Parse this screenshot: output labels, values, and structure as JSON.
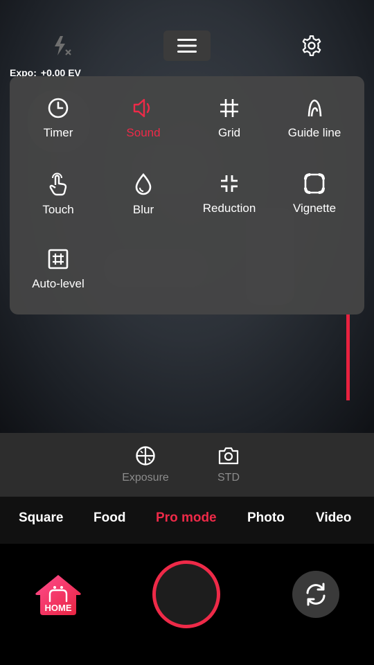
{
  "top_bar": {
    "flash_icon": "flash-off-icon",
    "menu_icon": "hamburger-menu-icon",
    "settings_icon": "gear-icon"
  },
  "exposure_readout": {
    "label": "Expo:",
    "value": "+0.00 EV"
  },
  "settings_panel": {
    "options": [
      {
        "label": "Timer",
        "icon": "clock-icon",
        "active": false
      },
      {
        "label": "Sound",
        "icon": "speaker-icon",
        "active": true
      },
      {
        "label": "Grid",
        "icon": "grid-hash-icon",
        "active": false
      },
      {
        "label": "Guide line",
        "icon": "guide-line-icon",
        "active": false
      },
      {
        "label": "Touch",
        "icon": "touch-hand-icon",
        "active": false
      },
      {
        "label": "Blur",
        "icon": "drop-icon",
        "active": false
      },
      {
        "label": "Reduction",
        "icon": "reduction-arrows-icon",
        "active": false
      },
      {
        "label": "Vignette",
        "icon": "vignette-icon",
        "active": false
      },
      {
        "label": "Auto-level",
        "icon": "auto-level-icon",
        "active": false
      }
    ]
  },
  "pro_controls": [
    {
      "label": "Exposure",
      "icon": "exposure-icon"
    },
    {
      "label": "STD",
      "icon": "camera-icon"
    }
  ],
  "mode_tabs": [
    {
      "label": "Square",
      "active": false
    },
    {
      "label": "Food",
      "active": false
    },
    {
      "label": "Pro mode",
      "active": true
    },
    {
      "label": "Photo",
      "active": false
    },
    {
      "label": "Video",
      "active": false
    }
  ],
  "bottom_bar": {
    "home_label": "HOME",
    "home_icon": "home-icon",
    "flip_icon": "flip-camera-icon"
  },
  "colors": {
    "accent": "#ee2a48",
    "panel": "#464646",
    "text": "#ffffff",
    "muted": "#8c8c8c"
  }
}
